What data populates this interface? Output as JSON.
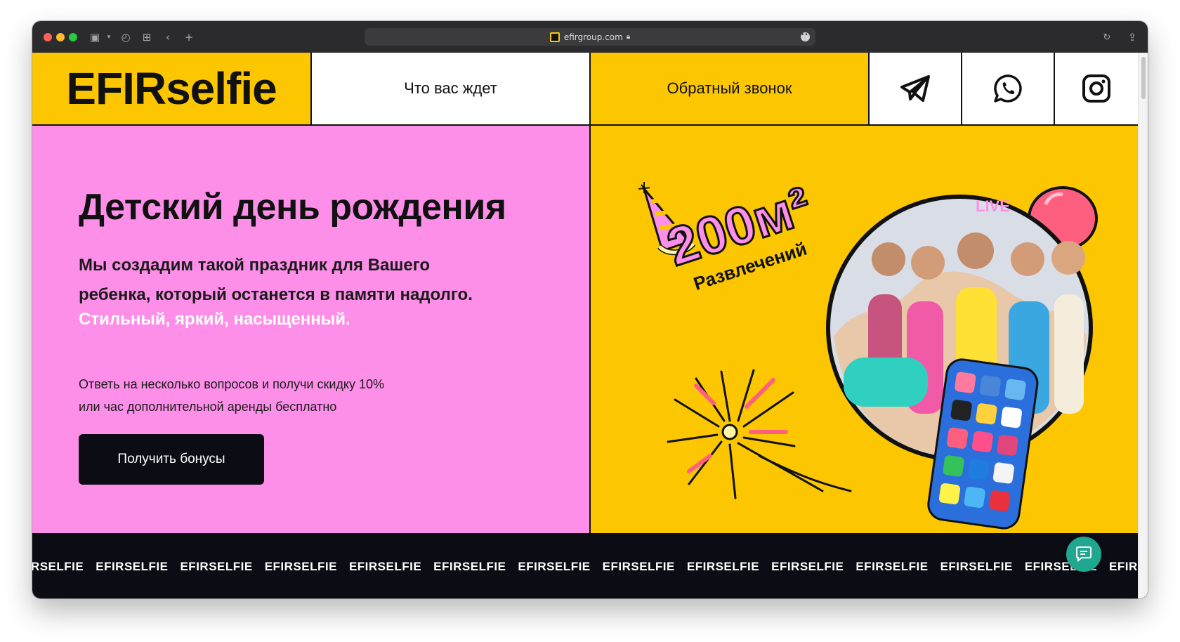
{
  "browser": {
    "url": "efirgroup.com"
  },
  "nav": {
    "logo": "EFIRselfie",
    "links": [
      "Что вас ждет",
      "Обратный звонок"
    ],
    "social": [
      "telegram-icon",
      "whatsapp-icon",
      "instagram-icon"
    ]
  },
  "hero": {
    "title": "Детский день рождения",
    "subtitle": "Мы создадим такой праздник для Вашего ребенка, который останется в памяти надолго.",
    "tagline": "Стильный, яркий, насыщенный.",
    "quiz_text": "Ответь на несколько вопросов и получи скидку 10% или час дополнительной аренды бесплатно",
    "cta": "Получить бонусы",
    "badge_area": "200м²",
    "badge_caption": "Развлечений",
    "photo_live": "LIVE"
  },
  "marquee": {
    "items": [
      "EFIRSELFIE",
      "EFIRSELFIE",
      "EFIRSELFIE",
      "EFIRSELFIE",
      "EFIRSELFIE",
      "EFIRSELFIE",
      "EFIRSELFIE",
      "EFIRSELFIE",
      "EFIRSELFIE",
      "EFIRSELFIE",
      "EFIRSELFIE",
      "EFIRSELFIE",
      "EFIRSELFIE",
      "EFIRSELFIE",
      "EFIRSELFIE",
      "EFIRSELFIE"
    ]
  },
  "colors": {
    "yellow": "#fcc700",
    "pink": "#fd8fe9",
    "dark": "#0c0d14",
    "chat": "#1fa88f"
  }
}
